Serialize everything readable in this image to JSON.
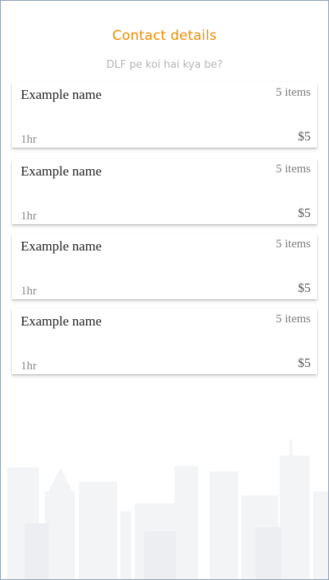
{
  "header": {
    "title": "Contact details",
    "subtitle": "DLF pe koi hai kya be?"
  },
  "cards": [
    {
      "name": "Example name",
      "items": "5 items",
      "time": "1hr",
      "price": "$5"
    },
    {
      "name": "Example name",
      "items": "5 items",
      "time": "1hr",
      "price": "$5"
    },
    {
      "name": "Example name",
      "items": "5 items",
      "time": "1hr",
      "price": "$5"
    },
    {
      "name": "Example name",
      "items": "5 items",
      "time": "1hr",
      "price": "$5"
    }
  ],
  "colors": {
    "accent": "#f08c00",
    "subtitle": "#b5b5b5",
    "border": "#8da2b5"
  }
}
